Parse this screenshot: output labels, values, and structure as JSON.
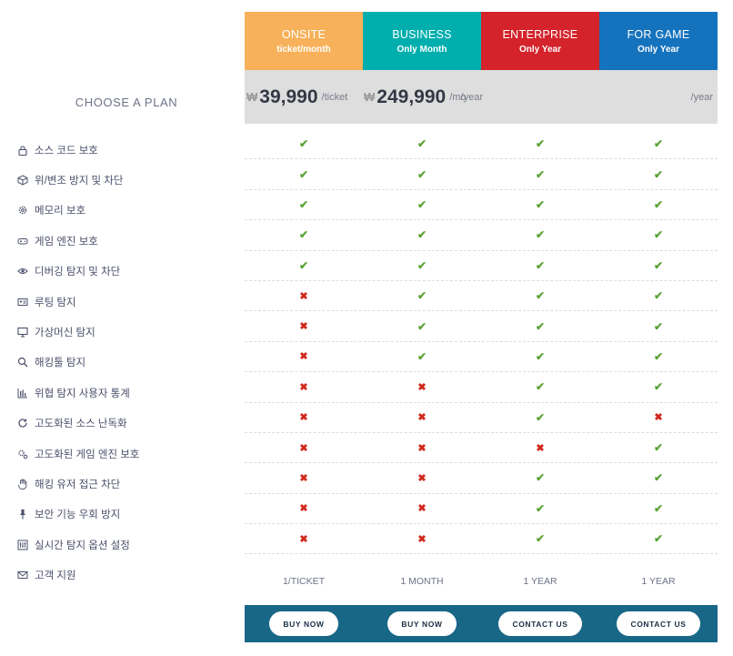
{
  "choose_label": "CHOOSE A PLAN",
  "plans": [
    {
      "name": "ONSITE",
      "sub": "ticket/month",
      "color": "#f7b15a",
      "currency": "₩",
      "amount": "39,990",
      "period": "/ticket",
      "term": "1/TICKET",
      "button": "BUY NOW"
    },
    {
      "name": "BUSINESS",
      "sub": "Only Month",
      "color": "#00aeae",
      "currency": "₩",
      "amount": "249,990",
      "period": "/mo",
      "term": "1 MONTH",
      "button": "BUY NOW"
    },
    {
      "name": "ENTERPRISE",
      "sub": "Only Year",
      "color": "#d4232b",
      "currency": "",
      "amount": "",
      "period": "/year",
      "term": "1 YEAR",
      "button": "CONTACT US"
    },
    {
      "name": "FOR GAME",
      "sub": "Only Year",
      "color": "#1573be",
      "currency": "",
      "amount": "",
      "period": "/year",
      "term": "1 YEAR",
      "button": "CONTACT US"
    }
  ],
  "features": [
    {
      "label": "소스 코드 보호",
      "icon": "lock-icon",
      "marks": [
        "ok",
        "ok",
        "ok",
        "ok"
      ]
    },
    {
      "label": "위/변조 방지 및 차단",
      "icon": "cube-icon",
      "marks": [
        "ok",
        "ok",
        "ok",
        "ok"
      ]
    },
    {
      "label": "메모리 보호",
      "icon": "gear-icon",
      "marks": [
        "ok",
        "ok",
        "ok",
        "ok"
      ]
    },
    {
      "label": "게임 엔진 보호",
      "icon": "gamepad-icon",
      "marks": [
        "ok",
        "ok",
        "ok",
        "ok"
      ]
    },
    {
      "label": "디버깅 탐지 및 차단",
      "icon": "eye-icon",
      "marks": [
        "ok",
        "ok",
        "ok",
        "ok"
      ]
    },
    {
      "label": "루팅 탐지",
      "icon": "id-card-icon",
      "marks": [
        "no",
        "ok",
        "ok",
        "ok"
      ]
    },
    {
      "label": "가상머신 탐지",
      "icon": "monitor-icon",
      "marks": [
        "no",
        "ok",
        "ok",
        "ok"
      ]
    },
    {
      "label": "해킹툴 탐지",
      "icon": "search-icon",
      "marks": [
        "no",
        "ok",
        "ok",
        "ok"
      ]
    },
    {
      "label": "위협 탐지 사용자 통계",
      "icon": "bar-chart-icon",
      "marks": [
        "no",
        "no",
        "ok",
        "ok"
      ]
    },
    {
      "label": "고도화된 소스 난독화",
      "icon": "refresh-icon",
      "marks": [
        "no",
        "no",
        "ok",
        "no"
      ]
    },
    {
      "label": "고도화된 게임 엔진 보호",
      "icon": "gears-icon",
      "marks": [
        "no",
        "no",
        "no",
        "ok"
      ]
    },
    {
      "label": "해킹 유저 접근 차단",
      "icon": "hand-icon",
      "marks": [
        "no",
        "no",
        "ok",
        "ok"
      ]
    },
    {
      "label": "보안 기능 우회 방지",
      "icon": "pin-icon",
      "marks": [
        "no",
        "no",
        "ok",
        "ok"
      ]
    },
    {
      "label": "실시간 탐지 옵션 설정",
      "icon": "sliders-icon",
      "marks": [
        "no",
        "no",
        "ok",
        "ok"
      ]
    },
    {
      "label": "고객 지원",
      "icon": "envelope-icon",
      "marks": []
    }
  ],
  "mark_glyphs": {
    "ok": "✔",
    "no": "✖"
  },
  "colors": {
    "check": "#5ca337",
    "cross": "#d0281c",
    "price_band": "#dedede",
    "action_bar": "#196787"
  }
}
